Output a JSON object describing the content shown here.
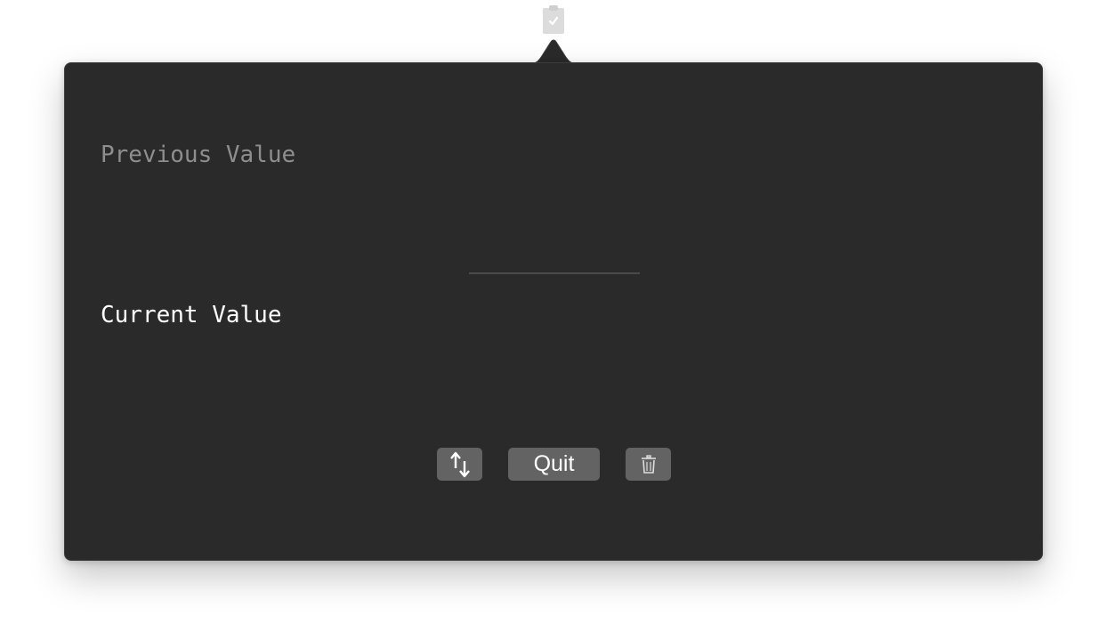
{
  "menubar": {
    "icon": "clipboard-check-icon"
  },
  "popover": {
    "previous_value": "Previous Value",
    "current_value": "Current Value"
  },
  "toolbar": {
    "swap_icon": "swap-arrows-icon",
    "quit_label": "Quit",
    "trash_icon": "trash-icon"
  },
  "colors": {
    "panel_background": "#2a2a2a",
    "button_background": "#636363",
    "previous_text": "#8e8e8e",
    "current_text": "#ffffff"
  }
}
